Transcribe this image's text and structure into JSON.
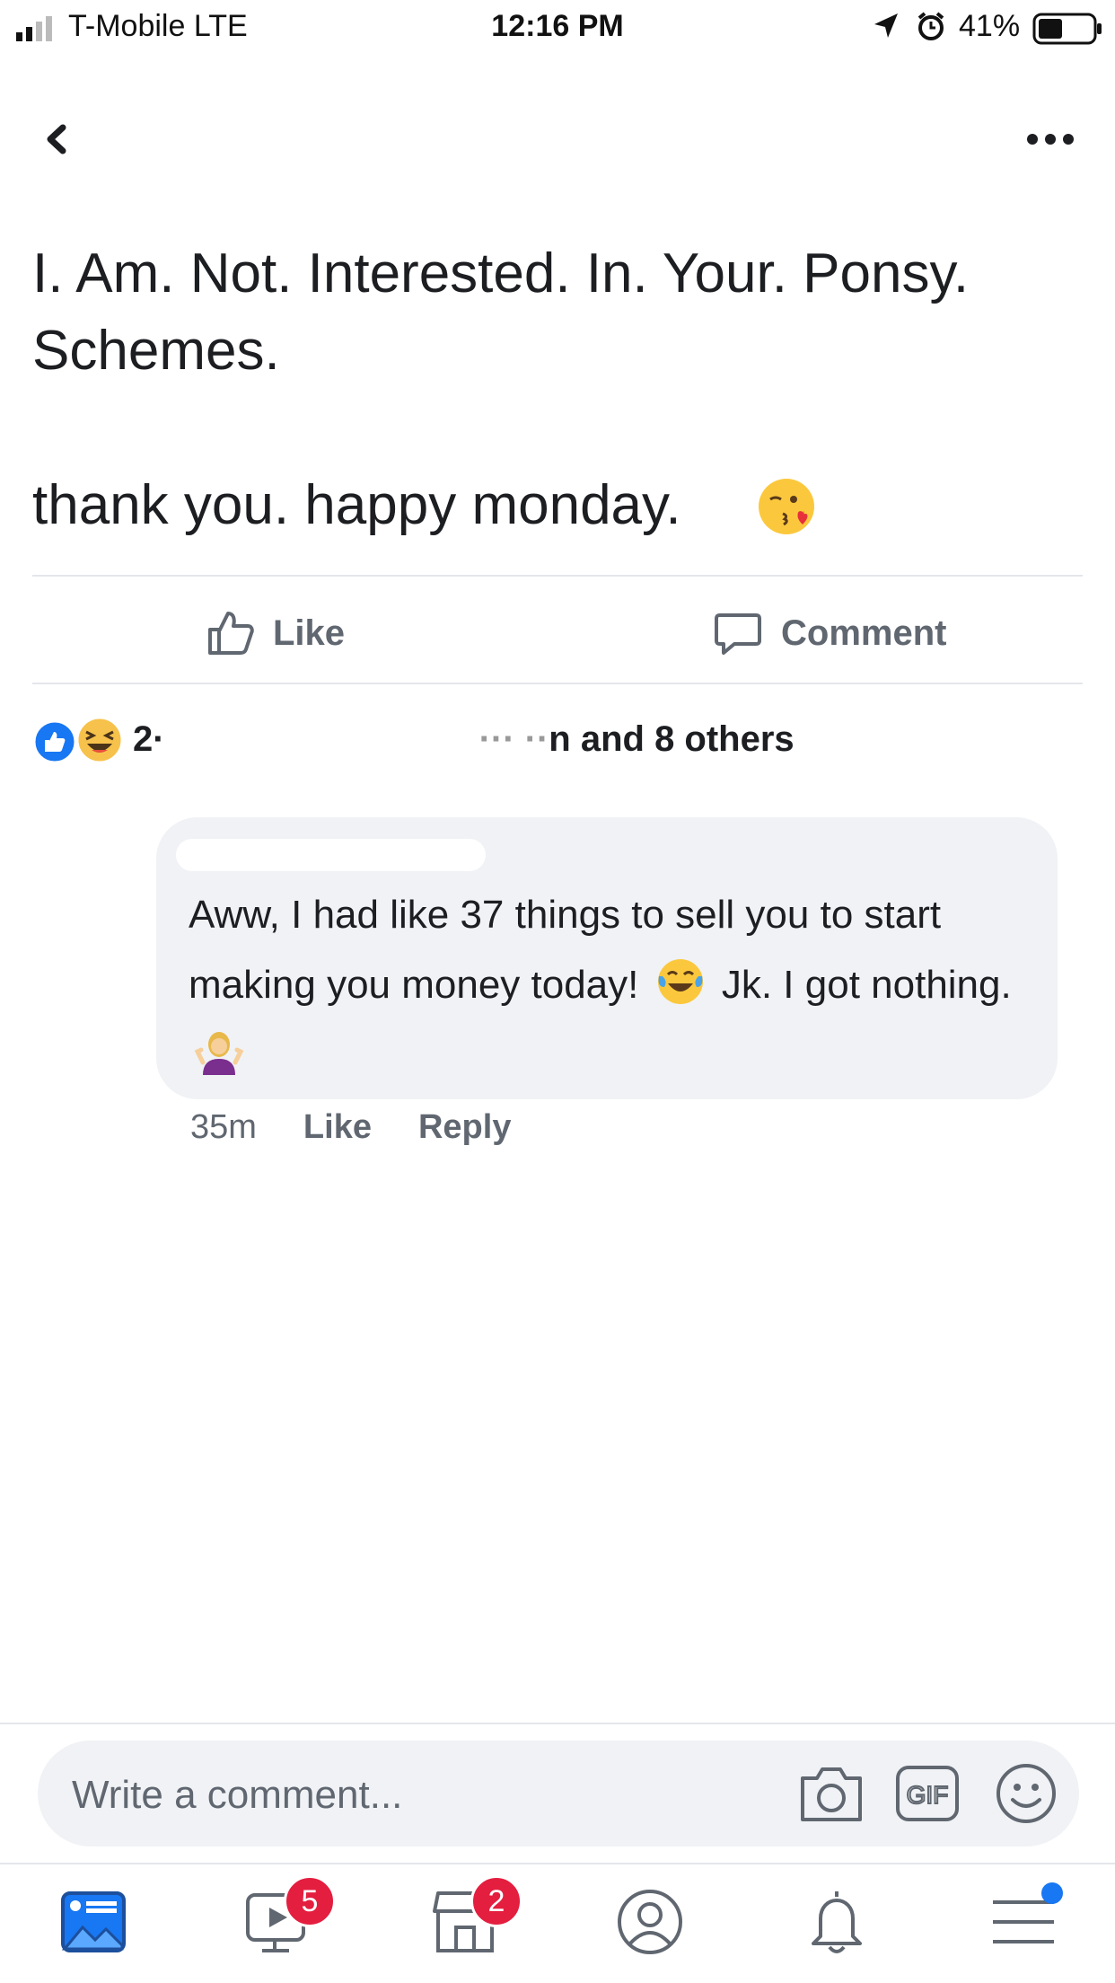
{
  "status_bar": {
    "carrier": "T-Mobile  LTE",
    "time": "12:16 PM",
    "battery": "41%"
  },
  "nav": {
    "back_icon": "chevron-left-icon",
    "more_icon": "more-dots-icon"
  },
  "post": {
    "text": "I. Am. Not. Interested. In. Your. Ponsy.\nSchemes.",
    "line3": "thank you. happy monday.",
    "emoji": "kissing-heart-emoji"
  },
  "actions": {
    "like_label": "Like",
    "comment_label": "Comment"
  },
  "reactions": {
    "summary_visible": "and 8 others",
    "icons": [
      "like-reaction-icon",
      "haha-reaction-icon"
    ]
  },
  "comment": {
    "text_part1": "Aww, I had like 37 things to sell you to start making you money today!",
    "text_part2": "Jk. I got nothing.",
    "time": "35m",
    "like_label": "Like",
    "reply_label": "Reply"
  },
  "composer": {
    "placeholder": "Write a comment..."
  },
  "tabbar": {
    "watch_badge": "5",
    "marketplace_badge": "2",
    "accent": "#1877f2",
    "badge_color": "#e41e3f"
  }
}
